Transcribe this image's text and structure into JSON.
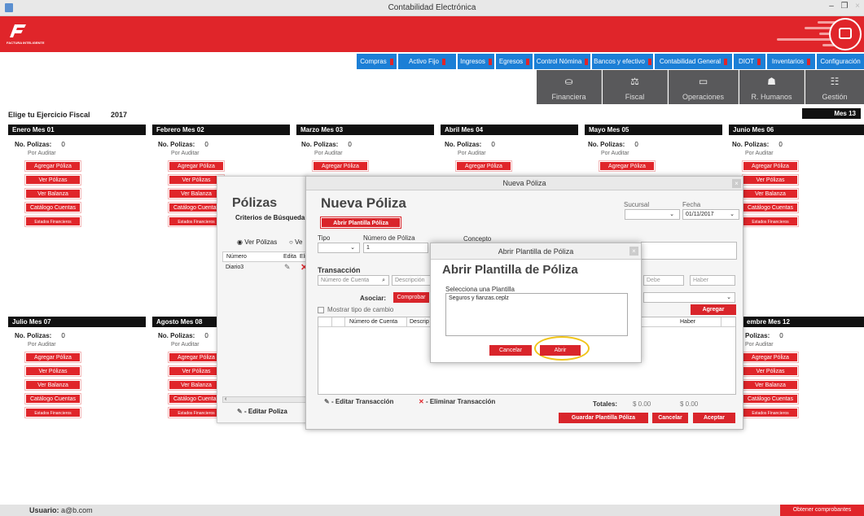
{
  "window": {
    "title": "Contabilidad Electrónica"
  },
  "brand": {
    "name": "FACTURA INTELIGENTE",
    "color": "#e0252a"
  },
  "menu_tabs": [
    "Compras",
    "Activo Fijo",
    "Ingresos",
    "Egresos",
    "Control Nómina",
    "Bancos y efectivo",
    "Contabilidad General",
    "DIOT",
    "Inventarios",
    "Configuración"
  ],
  "nav": [
    {
      "label": "Financiera",
      "icon": "coins-icon"
    },
    {
      "label": "Fiscal",
      "icon": "scale-icon"
    },
    {
      "label": "Operaciones",
      "icon": "monitor-icon"
    },
    {
      "label": "R. Humanos",
      "icon": "person-icon"
    },
    {
      "label": "Gestión",
      "icon": "hierarchy-icon"
    }
  ],
  "ejercicio": {
    "label": "Elige tu Ejercicio Fiscal",
    "year": "2017",
    "mes13": "Mes 13"
  },
  "months": {
    "m01": "Enero Mes 01",
    "m02": "Febrero Mes 02",
    "m03": "Marzo Mes 03",
    "m04": "Abril Mes 04",
    "m05": "Mayo Mes 05",
    "m06": "Junio Mes 06",
    "m07": "Julio Mes 07",
    "m08": "Agosto Mes 08",
    "m12": "embre Mes 12"
  },
  "month_common": {
    "polizas_label": "No. Polizas:",
    "polizas_count": "0",
    "status": "Por Auditar",
    "btn_agregar": "Agregar Póliza",
    "btn_ver": "Ver Pólizas",
    "btn_balanza": "Ver Balanza",
    "btn_catalogo": "Catálogo Cuentas",
    "btn_estados": "Estados Financieros",
    "polizas_label_cut": "Polizas:",
    "status_cut": "Por Auditar"
  },
  "polizas": {
    "title": "Pólizas",
    "criterios": "Criterios de Búsqueda",
    "radio_ver": "Ver Pólizas",
    "radio_other": "Ve",
    "cols": [
      "Número",
      "Edita",
      "Elim"
    ],
    "row": "Diario3",
    "editar": "- Editar Poliza"
  },
  "nueva_poliza": {
    "dialog_title": "Nueva Póliza",
    "heading": "Nueva Póliza",
    "btn_abrir_plantilla": "Abrir Plantilla Póliza",
    "sucursal_label": "Sucursal",
    "fecha_label": "Fecha",
    "fecha_value": "01/11/2017",
    "tipo_label": "Tipo",
    "numero_label": "Número de Póliza",
    "numero_value": "1",
    "concepto_label": "Concepto",
    "transaccion_label": "Transacción",
    "cuenta_placeholder": "Número de Cuenta",
    "descripcion_placeholder": "Descripción",
    "debe_placeholder": "Debe",
    "haber_placeholder": "Haber",
    "asociar_label": "Asociar:",
    "btn_comprobante": "Comprobar",
    "mostrar_tipo": "Mostrar tipo de cambio",
    "btn_agregar": "Agregar",
    "grid_cols": [
      "Número de Cuenta",
      "Descrip",
      "Haber"
    ],
    "editar_trans": "- Editar Transacción",
    "eliminar_trans": "- Eliminar Transacción",
    "totales_label": "Totales:",
    "total_debe": "$ 0.00",
    "total_haber": "$ 0.00",
    "btn_guardar": "Guardar Plantilla Póliza",
    "btn_cancelar": "Cancelar",
    "btn_aceptar": "Aceptar"
  },
  "plantilla": {
    "dialog_title": "Abrir Plantilla de Póliza",
    "heading": "Abrir Plantilla de Póliza",
    "select_label": "Selecciona una Plantilla",
    "items": [
      "Seguros y fianzas.ceplz"
    ],
    "btn_cancelar": "Cancelar",
    "btn_abrir": "Abrir"
  },
  "status": {
    "user_label": "Usuario:",
    "user_value": "a@b.com",
    "btn_obtener": "Obtener comprobantes"
  }
}
